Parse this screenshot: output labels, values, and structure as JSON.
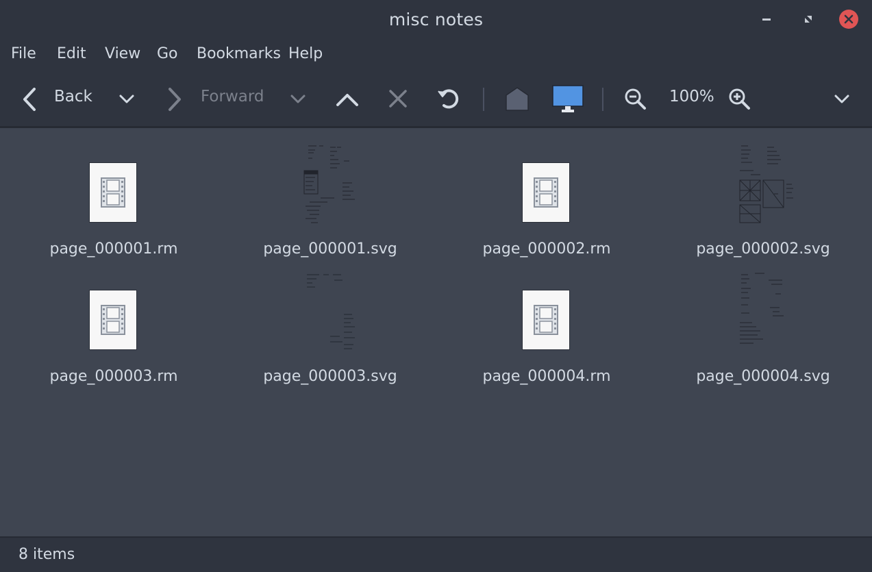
{
  "window": {
    "title": "misc notes",
    "close_color": "#e05555"
  },
  "menu": [
    "File",
    "Edit",
    "View",
    "Go",
    "Bookmarks",
    "Help"
  ],
  "toolbar": {
    "back_label": "Back",
    "forward_label": "Forward",
    "zoom_level": "100%",
    "accent_color": "#5294e2"
  },
  "files": [
    {
      "name": "page_000001.rm",
      "kind": "rm"
    },
    {
      "name": "page_000001.svg",
      "kind": "svg"
    },
    {
      "name": "page_000002.rm",
      "kind": "rm"
    },
    {
      "name": "page_000002.svg",
      "kind": "svg"
    },
    {
      "name": "page_000003.rm",
      "kind": "rm"
    },
    {
      "name": "page_000003.svg",
      "kind": "svg"
    },
    {
      "name": "page_000004.rm",
      "kind": "rm"
    },
    {
      "name": "page_000004.svg",
      "kind": "svg"
    }
  ],
  "status": {
    "item_count": "8 items"
  }
}
